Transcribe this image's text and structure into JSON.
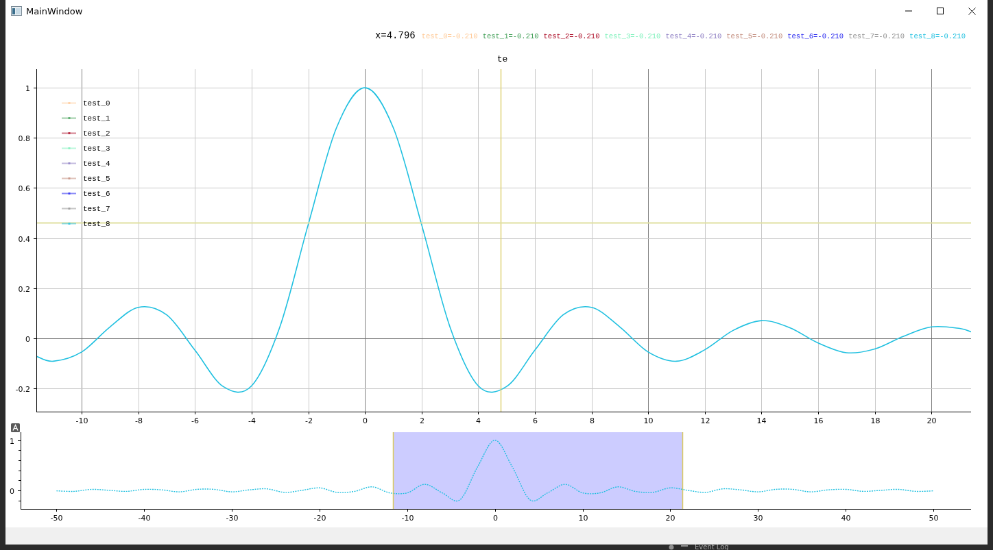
{
  "window": {
    "title": "MainWindow"
  },
  "readout": {
    "x_label": "x=4.796",
    "values": [
      {
        "label": "test_0=-0.210",
        "color": "#ffc894"
      },
      {
        "label": "test_1=-0.210",
        "color": "#3c9c52"
      },
      {
        "label": "test_2=-0.210",
        "color": "#a8001c"
      },
      {
        "label": "test_3=-0.210",
        "color": "#78f0b8"
      },
      {
        "label": "test_4=-0.210",
        "color": "#8878c0"
      },
      {
        "label": "test_5=-0.210",
        "color": "#c08878"
      },
      {
        "label": "test_6=-0.210",
        "color": "#2020f0"
      },
      {
        "label": "test_7=-0.210",
        "color": "#909090"
      },
      {
        "label": "test_8=-0.210",
        "color": "#20c0e0"
      }
    ]
  },
  "plot": {
    "chart_data": {
      "type": "line",
      "title": "te",
      "x": [
        -11.6,
        -11,
        -10,
        -9,
        -8,
        -7,
        -6,
        -5,
        -4,
        -3,
        -2,
        -1,
        0,
        1,
        2,
        3,
        4,
        5,
        6,
        7,
        8,
        9,
        10,
        11,
        12,
        13,
        14,
        15,
        16,
        17,
        18,
        19,
        20,
        21,
        21.4
      ],
      "series": [
        {
          "name": "test_0",
          "color": "#ffc894",
          "values": [
            null,
            null,
            null,
            null,
            null,
            null,
            null,
            null,
            null,
            null,
            null,
            null,
            null,
            null,
            null,
            null,
            null,
            null,
            null,
            null,
            null,
            null,
            null,
            null,
            null,
            null,
            null,
            null,
            null,
            null,
            null,
            null,
            null,
            null,
            null
          ]
        },
        {
          "name": "test_1",
          "color": "#3c9c52",
          "values": [
            null,
            null,
            null,
            null,
            null,
            null,
            null,
            null,
            null,
            null,
            null,
            null,
            null,
            null,
            null,
            null,
            null,
            null,
            null,
            null,
            null,
            null,
            null,
            null,
            null,
            null,
            null,
            null,
            null,
            null,
            null,
            null,
            null,
            null,
            null
          ]
        },
        {
          "name": "test_2",
          "color": "#a8001c",
          "values": [
            null,
            null,
            null,
            null,
            null,
            null,
            null,
            null,
            null,
            null,
            null,
            null,
            null,
            null,
            null,
            null,
            null,
            null,
            null,
            null,
            null,
            null,
            null,
            null,
            null,
            null,
            null,
            null,
            null,
            null,
            null,
            null,
            null,
            null,
            null
          ]
        },
        {
          "name": "test_3",
          "color": "#78f0b8",
          "values": [
            null,
            null,
            null,
            null,
            null,
            null,
            null,
            null,
            null,
            null,
            null,
            null,
            null,
            null,
            null,
            null,
            null,
            null,
            null,
            null,
            null,
            null,
            null,
            null,
            null,
            null,
            null,
            null,
            null,
            null,
            null,
            null,
            null,
            null,
            null
          ]
        },
        {
          "name": "test_4",
          "color": "#8878c0",
          "values": [
            null,
            null,
            null,
            null,
            null,
            null,
            null,
            null,
            null,
            null,
            null,
            null,
            null,
            null,
            null,
            null,
            null,
            null,
            null,
            null,
            null,
            null,
            null,
            null,
            null,
            null,
            null,
            null,
            null,
            null,
            null,
            null,
            null,
            null,
            null
          ]
        },
        {
          "name": "test_5",
          "color": "#c08878",
          "values": [
            null,
            null,
            null,
            null,
            null,
            null,
            null,
            null,
            null,
            null,
            null,
            null,
            null,
            null,
            null,
            null,
            null,
            null,
            null,
            null,
            null,
            null,
            null,
            null,
            null,
            null,
            null,
            null,
            null,
            null,
            null,
            null,
            null,
            null,
            null
          ]
        },
        {
          "name": "test_6",
          "color": "#2020f0",
          "values": [
            null,
            null,
            null,
            null,
            null,
            null,
            null,
            null,
            null,
            null,
            null,
            null,
            null,
            null,
            null,
            null,
            null,
            null,
            null,
            null,
            null,
            null,
            null,
            null,
            null,
            null,
            null,
            null,
            null,
            null,
            null,
            null,
            null,
            null,
            null
          ]
        },
        {
          "name": "test_7",
          "color": "#909090",
          "values": [
            null,
            null,
            null,
            null,
            null,
            null,
            null,
            null,
            null,
            null,
            null,
            null,
            null,
            null,
            null,
            null,
            null,
            null,
            null,
            null,
            null,
            null,
            null,
            null,
            null,
            null,
            null,
            null,
            null,
            null,
            null,
            null,
            null,
            null,
            null
          ]
        },
        {
          "name": "test_8",
          "color": "#20c0e0",
          "values": [
            -0.071,
            -0.091,
            -0.054,
            0.046,
            0.124,
            0.094,
            -0.047,
            -0.192,
            -0.189,
            0.047,
            0.455,
            0.841,
            1,
            0.841,
            0.455,
            0.047,
            -0.189,
            -0.192,
            -0.047,
            0.094,
            0.124,
            0.046,
            -0.054,
            -0.091,
            -0.045,
            0.032,
            0.071,
            0.043,
            -0.018,
            -0.057,
            -0.042,
            0.008,
            0.046,
            0.04,
            0.026
          ]
        }
      ],
      "xlim": [
        -11.6,
        21.4
      ],
      "ylim": [
        -0.292,
        1.074
      ],
      "xticks": [
        -10,
        -8,
        -6,
        -4,
        -2,
        0,
        2,
        4,
        6,
        8,
        10,
        12,
        14,
        16,
        18,
        20
      ],
      "yticks": [
        -0.2,
        0,
        0.2,
        0.4,
        0.6,
        0.8,
        1
      ],
      "grid": true,
      "legend": true,
      "ref_lines": [
        {
          "axis": "x",
          "value": 4.796
        },
        {
          "axis": "y",
          "value": 0.462
        }
      ]
    }
  },
  "overview": {
    "chart_data": {
      "type": "line",
      "x": [
        -50,
        -48,
        -46,
        -44,
        -42,
        -40,
        -38,
        -36,
        -34,
        -32,
        -30,
        -28,
        -26,
        -24,
        -22,
        -20,
        -18,
        -16,
        -14,
        -12,
        -10,
        -8,
        -6,
        -4,
        -2,
        0,
        2,
        4,
        6,
        8,
        10,
        12,
        14,
        16,
        18,
        20,
        22,
        24,
        26,
        28,
        30,
        32,
        34,
        36,
        38,
        40,
        42,
        44,
        46,
        48,
        50
      ],
      "series": [
        {
          "color": "#20c0e0",
          "line_style": "dotted",
          "values": [
            -0.01,
            -0.02,
            0.02,
            0,
            -0.02,
            0.02,
            0.01,
            -0.03,
            0.02,
            0.02,
            -0.03,
            0.01,
            0.03,
            -0.04,
            0,
            0.05,
            -0.04,
            -0.02,
            0.07,
            -0.05,
            -0.05,
            0.12,
            -0.05,
            -0.19,
            0.46,
            1,
            0.46,
            -0.19,
            -0.05,
            0.12,
            -0.05,
            -0.05,
            0.07,
            -0.02,
            -0.04,
            0.05,
            0,
            -0.04,
            0.03,
            0.01,
            -0.03,
            0.02,
            0.02,
            -0.03,
            0.01,
            0.02,
            -0.02,
            0,
            0.02,
            -0.02,
            -0.01
          ]
        }
      ],
      "xlim": [
        -54.1,
        54.3
      ],
      "ylim": [
        -0.37,
        1.16
      ],
      "xticks": [
        -50,
        -40,
        -30,
        -20,
        -10,
        0,
        10,
        20,
        30,
        40,
        50
      ],
      "yticks": [
        0,
        1
      ],
      "bands": [
        {
          "axis": "x",
          "from": -11.6,
          "to": 21.4
        }
      ],
      "ref_lines": [
        {
          "axis": "x",
          "value": -11.6
        },
        {
          "axis": "x",
          "value": 21.4
        }
      ]
    }
  },
  "taskbar": {
    "label": "Event Log"
  }
}
